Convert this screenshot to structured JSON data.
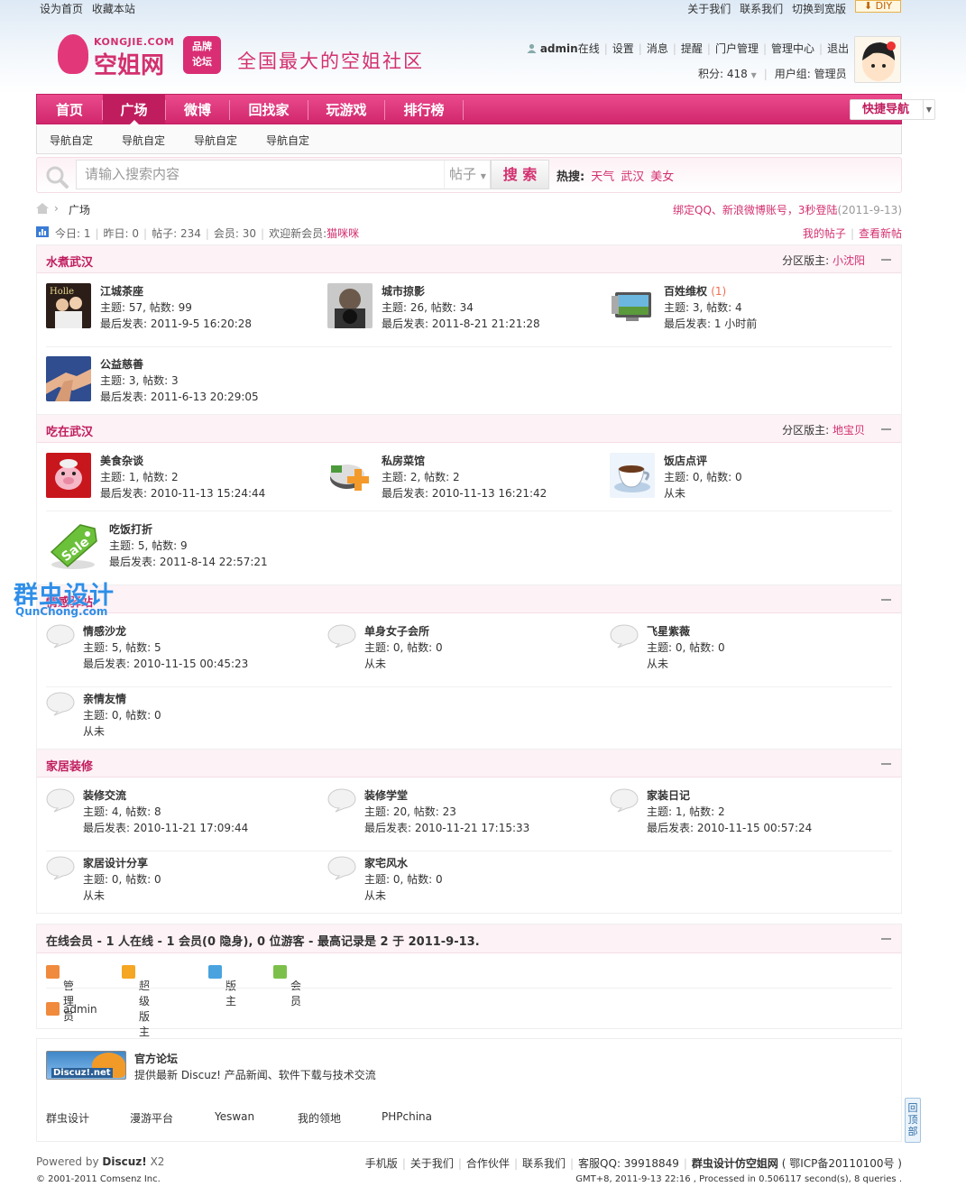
{
  "topbar": {
    "left": [
      "设为首页",
      "收藏本站"
    ],
    "right": [
      "关于我们",
      "联系我们",
      "切换到宽版"
    ],
    "diy": "DIY"
  },
  "logo": {
    "en": "KONGJIE.COM",
    "cn": "空姐网",
    "brand1": "品牌",
    "brand2": "论坛",
    "slogan": "全国最大的空姐社区"
  },
  "user": {
    "name": "admin",
    "status": "在线",
    "links": [
      "设置",
      "消息",
      "提醒",
      "门户管理",
      "管理中心",
      "退出"
    ],
    "points": "积分: 418",
    "group": "用户组: 管理员"
  },
  "nav": {
    "items": [
      "首页",
      "广场",
      "微博",
      "回找家",
      "玩游戏",
      "排行榜"
    ],
    "active": "广场",
    "quick": "快捷导航"
  },
  "subnav": [
    "导航自定",
    "导航自定",
    "导航自定",
    "导航自定"
  ],
  "search": {
    "placeholder": "请输入搜索内容",
    "type": "帖子",
    "button": "搜 索",
    "hot_label": "热搜:",
    "hot": [
      "天气",
      "武汉",
      "美女"
    ]
  },
  "breadcrumb": {
    "current": "广场",
    "notice": "绑定QQ、新浪微博账号，3秒登陆",
    "date": "(2011-9-13)"
  },
  "stats": {
    "today": "今日: 1",
    "yesterday": "昨日: 0",
    "posts": "帖子: 234",
    "members": "会员: 30",
    "welcome": "欢迎新会员:",
    "newuser": "猫咪咪",
    "my_posts": "我的帖子",
    "new_posts": "查看新帖"
  },
  "sections": [
    {
      "title": "水煮武汉",
      "mod_label": "分区版主:",
      "mod": "小沈阳",
      "forums": [
        {
          "name": "江城茶座",
          "extra": "",
          "counts": "主题: 57, 帖数: 99",
          "last": "最后发表: 2011-9-5 16:20:28"
        },
        {
          "name": "城市掠影",
          "extra": "",
          "counts": "主题: 26, 帖数: 34",
          "last": "最后发表: 2011-8-21 21:21:28"
        },
        {
          "name": "百姓维权",
          "extra": "(1)",
          "counts": "主题: 3, 帖数: 4",
          "last": "最后发表: 1 小时前"
        },
        {
          "name": "公益慈善",
          "extra": "",
          "counts": "主题: 3, 帖数: 3",
          "last": "最后发表: 2011-6-13 20:29:05"
        }
      ]
    },
    {
      "title": "吃在武汉",
      "mod_label": "分区版主:",
      "mod": "地宝贝",
      "forums": [
        {
          "name": "美食杂谈",
          "counts": "主题: 1, 帖数: 2",
          "last": "最后发表: 2010-11-13 15:24:44"
        },
        {
          "name": "私房菜馆",
          "counts": "主题: 2, 帖数: 2",
          "last": "最后发表: 2010-11-13 16:21:42"
        },
        {
          "name": "饭店点评",
          "counts": "主题: 0, 帖数: 0",
          "last": "从未"
        },
        {
          "name": "吃饭打折",
          "counts": "主题: 5, 帖数: 9",
          "last": "最后发表: 2011-8-14 22:57:21"
        }
      ]
    },
    {
      "title": "情感驿站",
      "forums": [
        {
          "name": "情感沙龙",
          "counts": "主题: 5, 帖数: 5",
          "last": "最后发表: 2010-11-15 00:45:23"
        },
        {
          "name": "单身女子会所",
          "counts": "主题: 0, 帖数: 0",
          "last": "从未"
        },
        {
          "name": "飞星紫薇",
          "counts": "主题: 0, 帖数: 0",
          "last": "从未"
        },
        {
          "name": "亲情友情",
          "counts": "主题: 0, 帖数: 0",
          "last": "从未"
        }
      ]
    },
    {
      "title": "家居装修",
      "forums": [
        {
          "name": "装修交流",
          "counts": "主题: 4, 帖数: 8",
          "last": "最后发表: 2010-11-21 17:09:44"
        },
        {
          "name": "装修学堂",
          "counts": "主题: 20, 帖数: 23",
          "last": "最后发表: 2010-11-21 17:15:33"
        },
        {
          "name": "家装日记",
          "counts": "主题: 1, 帖数: 2",
          "last": "最后发表: 2010-11-15 00:57:24"
        },
        {
          "name": "家居设计分享",
          "counts": "主题: 0, 帖数: 0",
          "last": "从未"
        },
        {
          "name": "家宅风水",
          "counts": "主题: 0, 帖数: 0",
          "last": "从未"
        }
      ]
    }
  ],
  "online": {
    "title": "在线会员 - 1 人在线 - 1 会员(0 隐身), 0 位游客 - 最高记录是 2 于 2011-9-13.",
    "legend": [
      "管理员",
      "超级版主",
      "版主",
      "会员"
    ],
    "users": [
      "admin"
    ],
    "colors": [
      "#f08a3c",
      "#f5a623",
      "#4aa3df",
      "#7cc04b"
    ]
  },
  "links": {
    "title": "官方论坛",
    "desc": "提供最新 Discuz! 产品新闻、软件下载与技术交流",
    "logo_text": "Discuz!.net",
    "items": [
      "群虫设计",
      "漫游平台",
      "Yeswan",
      "我的领地",
      "PHPchina"
    ]
  },
  "footer": {
    "powered": "Powered by",
    "product": "Discuz!",
    "ver": "X2",
    "copyright": "© 2001-2011 Comsenz Inc.",
    "links": [
      "手机版",
      "关于我们",
      "合作伙伴",
      "联系我们",
      "客服QQ: 39918849"
    ],
    "site": "群虫设计仿空姐网",
    "icp": "( 鄂ICP备20110100号 )",
    "stat": "GMT+8, 2011-9-13 22:16 , Processed in 0.506117 second(s), 8 queries ."
  },
  "totop": "回顶部",
  "watermark": {
    "cn": "群虫设计",
    "en": "QunChong.com"
  }
}
